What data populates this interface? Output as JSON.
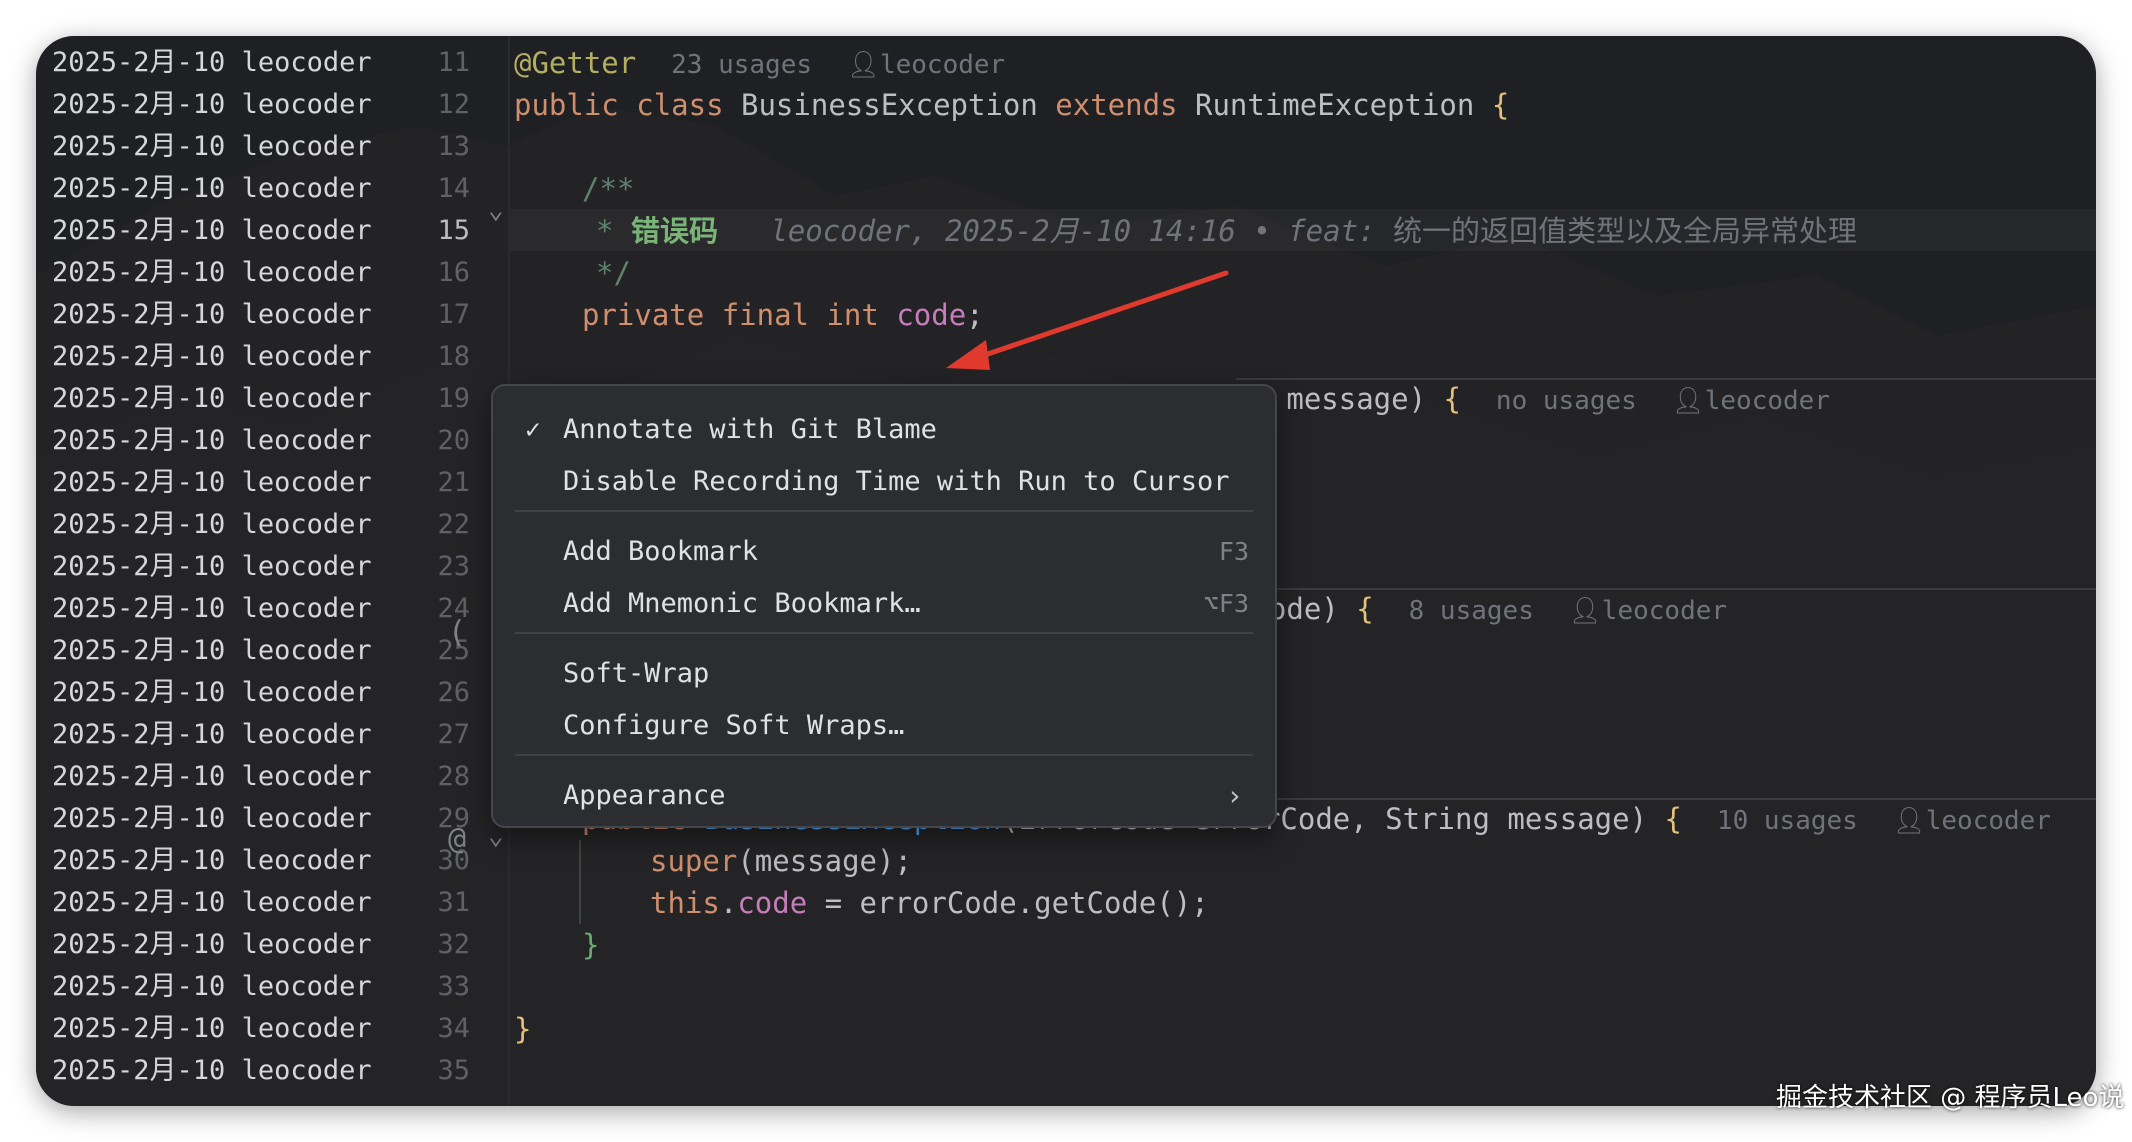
{
  "blame": {
    "date": "2025-2月-10",
    "author": "leocoder"
  },
  "lines": [
    "11",
    "12",
    "13",
    "14",
    "15",
    "16",
    "17",
    "18",
    "19",
    "20",
    "21",
    "22",
    "23",
    "24",
    "25",
    "26",
    "27",
    "28",
    "29",
    "30",
    "31",
    "32",
    "33",
    "34",
    "35"
  ],
  "code": {
    "getter": "@Getter",
    "getter_usages": "23 usages",
    "author": "leocoder",
    "kw_public": "public",
    "kw_class": "class",
    "class_name": "BusinessException",
    "kw_extends": "extends",
    "super_class": "RuntimeException",
    "open_brace": "{",
    "close_brace": "}",
    "doc_open": "/**",
    "doc_star": "*",
    "doc_title": "错误码",
    "inline_blame": "leocoder, 2025-2月-10 14:16 • feat:",
    "inline_commit": "统一的返回值类型以及全局异常处理",
    "doc_close": "*/",
    "kw_private": "private",
    "kw_final": "final",
    "kw_int": "int",
    "field_code": "code",
    "semicolon": ";",
    "ctor1_tail": "ng message)",
    "ctor1_usages": "no usages",
    "ctor2_tail": "rCode)",
    "ctor2_usages": "8 usages",
    "ctor3_name": "BusinessException",
    "ctor3_params": "(ErrorCode errorCode, String message)",
    "ctor3_usages": "10 usages",
    "super_kw": "super",
    "super_args": "(message);",
    "this_kw": "this",
    "assign": " = errorCode.getCode();",
    "dot": "."
  },
  "menu": {
    "check_mark": "✓",
    "items": [
      {
        "label": "Annotate with Git Blame",
        "shortcut": ""
      },
      {
        "label": "Disable Recording Time with Run to Cursor",
        "shortcut": ""
      },
      {
        "label": "Add Bookmark",
        "shortcut": "F3"
      },
      {
        "label": "Add Mnemonic Bookmark…",
        "shortcut": "⌥F3"
      },
      {
        "label": "Soft-Wrap",
        "shortcut": ""
      },
      {
        "label": "Configure Soft Wraps…",
        "shortcut": ""
      },
      {
        "label": "Appearance",
        "shortcut": ""
      }
    ],
    "submenu_arrow": "›"
  },
  "watermark": "掘金技术社区 @ 程序员Leo说",
  "icons": {
    "user": "user-icon",
    "fold": "chevron-down-icon",
    "annotation": "at-sign-icon"
  },
  "colors": {
    "editor_bg": "#1f2023",
    "keyword": "#cf8e6d",
    "annotation": "#b3ae60",
    "field": "#c77dbb",
    "method": "#56a8f5",
    "doc_comment": "#5f826b",
    "arrow": "#e03a2f"
  }
}
